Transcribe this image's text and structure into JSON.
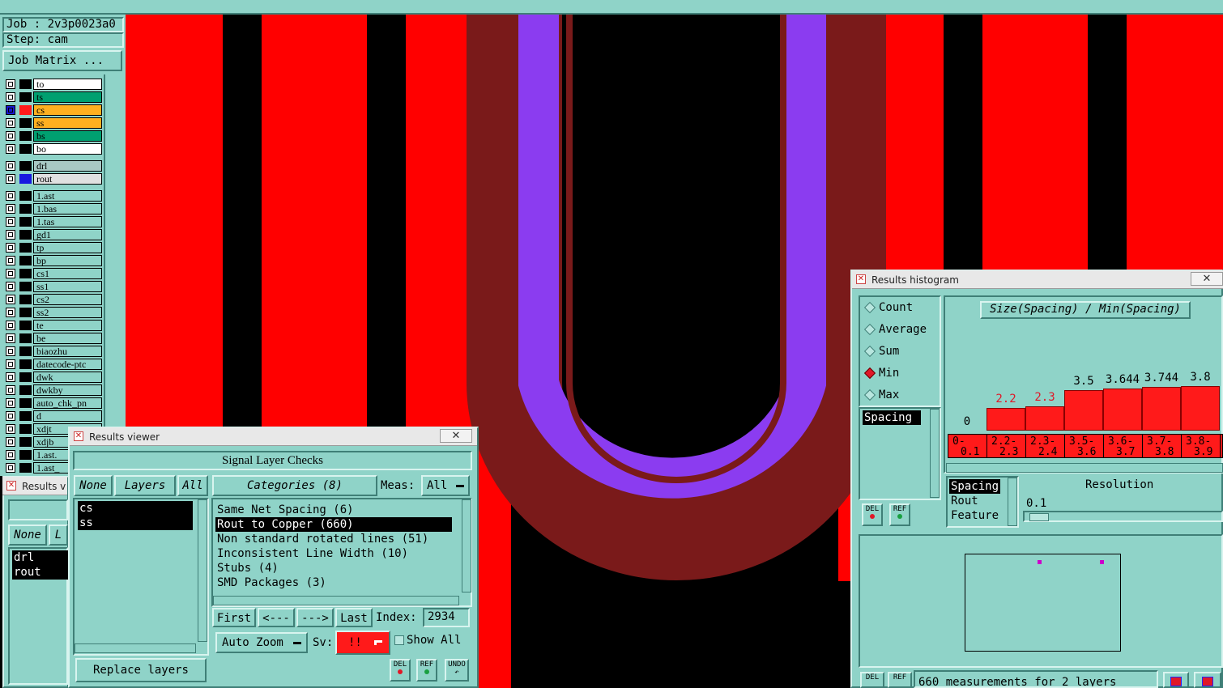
{
  "header": {
    "job_label": "Job : 2v3p0023a0",
    "step_label": "Step: cam",
    "job_matrix_button": "Job Matrix ..."
  },
  "layers_board": [
    {
      "name": "to",
      "color": "#ffffff"
    },
    {
      "name": "ts",
      "color": "#00a070"
    },
    {
      "name": "cs",
      "color": "#ffb020",
      "active": true
    },
    {
      "name": "ss",
      "color": "#ffb020"
    },
    {
      "name": "bs",
      "color": "#00a070"
    },
    {
      "name": "bo",
      "color": "#ffffff"
    }
  ],
  "layers_drill": [
    {
      "name": "drl",
      "color": "#a8c8c4"
    },
    {
      "name": "rout",
      "color": "#e0e0e0"
    }
  ],
  "layers_misc": [
    "1.ast",
    "1.bas",
    "1.tas",
    "gd1",
    "tp",
    "bp",
    "cs1",
    "ss1",
    "cs2",
    "ss2",
    "te",
    "be",
    "biaozhu",
    "datecode-ptc",
    "dwk",
    "dwkby",
    "auto_chk_pn",
    "d",
    "xdjt",
    "xdjb",
    "1.ast.",
    "1.ast_"
  ],
  "results_viewer": {
    "window_title": "Results viewer",
    "close_label": "✕",
    "panel_title": "Signal Layer Checks",
    "none_btn": "None",
    "layers_btn": "Layers",
    "all_btn": "All",
    "categories_btn": "Categories (8)",
    "meas_label": "Meas:",
    "meas_value": "All",
    "layers": [
      "cs",
      "ss"
    ],
    "categories": [
      {
        "label": "Same Net Spacing (6)",
        "selected": false
      },
      {
        "label": "Rout to Copper (660)",
        "selected": true
      },
      {
        "label": "Non standard rotated lines (51)",
        "selected": false
      },
      {
        "label": "Inconsistent Line Width (10)",
        "selected": false
      },
      {
        "label": "Stubs (4)",
        "selected": false
      },
      {
        "label": "SMD Packages (3)",
        "selected": false
      }
    ],
    "first_btn": "First",
    "prev_btn": "<---",
    "next_btn": "--->",
    "last_btn": "Last",
    "index_label": "Index:",
    "index_value": "2934",
    "auto_zoom": "Auto Zoom",
    "sv_label": "Sv:",
    "sv_value": "!!",
    "show_all": "Show All",
    "replace_layers": "Replace layers",
    "del_label": "DEL",
    "ref_label": "REF",
    "undo_label": "UNDO"
  },
  "results_viewer_back": {
    "window_title": "Results v",
    "none_btn": "None",
    "l_btn": "L",
    "layers": [
      "drl",
      "rout"
    ]
  },
  "histogram": {
    "window_title": "Results histogram",
    "close_label": "✕",
    "modes": [
      {
        "label": "Count",
        "on": false
      },
      {
        "label": "Average",
        "on": false
      },
      {
        "label": "Sum",
        "on": false
      },
      {
        "label": "Min",
        "on": true
      },
      {
        "label": "Max",
        "on": false
      }
    ],
    "param_list": [
      "Spacing"
    ],
    "chart_title": "Size(Spacing) / Min(Spacing)",
    "axis_list": [
      "Spacing",
      "Rout",
      "Feature"
    ],
    "resolution_label": "Resolution",
    "resolution_value": "0.1",
    "status": "660 measurements for 2 layers",
    "del_label": "DEL",
    "ref_label": "REF"
  },
  "chart_data": {
    "type": "bar",
    "title": "Size(Spacing) / Min(Spacing)",
    "categories": [
      "0-0.1",
      "2.2-2.3",
      "2.3-2.4",
      "3.5-3.6",
      "3.6-3.7",
      "3.7-3.8",
      "3.8-3.9"
    ],
    "values": [
      0,
      2.2,
      2.3,
      3.5,
      3.644,
      3.744,
      3.8
    ],
    "value_labels": [
      "0",
      "2.2",
      "2.3",
      "3.5",
      "3.644",
      "3.744",
      "3.8"
    ],
    "label_colors": [
      "#000000",
      "#e01828",
      "#e01828",
      "#000000",
      "#000000",
      "#000000",
      "#000000"
    ],
    "bin_lines": [
      [
        "0-",
        "0.1"
      ],
      [
        "2.2-",
        "2.3"
      ],
      [
        "2.3-",
        "2.4"
      ],
      [
        "3.5-",
        "3.6"
      ],
      [
        "3.6-",
        "3.7"
      ],
      [
        "3.7-",
        "3.8"
      ],
      [
        "3.8-",
        "3.9"
      ]
    ],
    "bar_color": "#ff1a1a",
    "ylim": [
      0,
      4
    ]
  },
  "colors": {
    "copper": "#ff0000",
    "rout_fill": "#8b3cf0",
    "rout_edge": "#8a1a1a",
    "panel": "#8fd3c8"
  }
}
